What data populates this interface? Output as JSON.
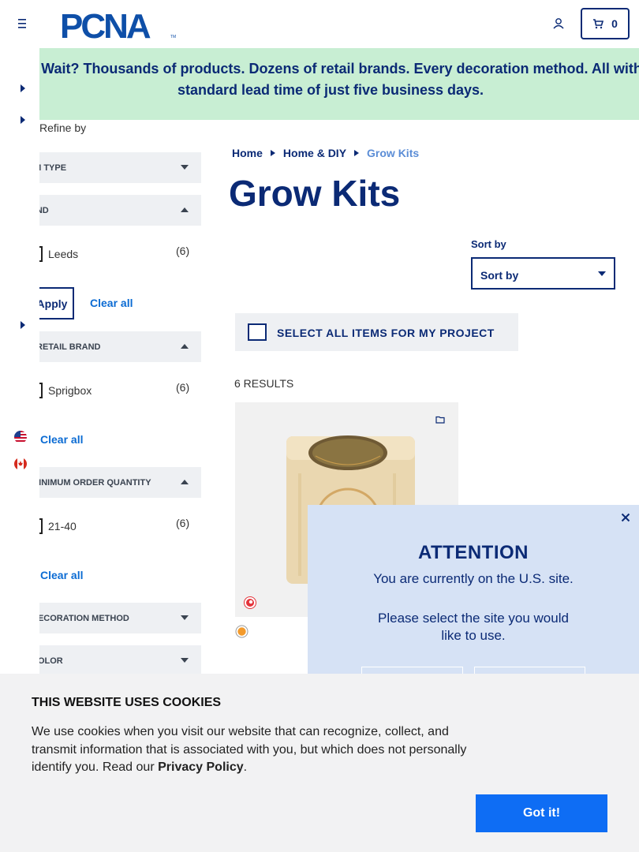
{
  "header": {
    "logo_text": "PCNA",
    "logo_tm": "TM",
    "cart_count": "0"
  },
  "banner": {
    "text": "Why Wait? Thousands of products. Dozens of retail brands. Every decoration method. All with a standard lead time of just five business days."
  },
  "filters": {
    "refine_label": "Refine by",
    "facets": [
      {
        "label": "ITEM TYPE"
      },
      {
        "label": "BRAND",
        "options": [
          {
            "name": "Leeds",
            "count": "(6)"
          }
        ]
      },
      {
        "label": "RETAIL BRAND",
        "options": [
          {
            "name": "Sprigbox",
            "count": "(6)"
          }
        ]
      },
      {
        "label": "MINIMUM ORDER QUANTITY",
        "options": [
          {
            "name": "21-40",
            "count": "(6)"
          }
        ]
      },
      {
        "label": "DECORATION METHOD"
      },
      {
        "label": "COLOR"
      }
    ],
    "apply_label": "Apply",
    "clear_all_label": "Clear all"
  },
  "breadcrumb": [
    "Home",
    "Home & DIY",
    "Grow Kits"
  ],
  "page_title": "Grow Kits",
  "sort": {
    "label": "Sort by",
    "selected": "Sort by"
  },
  "select_all_label": "SELECT ALL ITEMS FOR MY PROJECT",
  "results_label": "6 RESULTS",
  "modal": {
    "title": "ATTENTION",
    "message": "You are currently on the U.S. site.",
    "question": "Please select the site you would like to use."
  },
  "cookie": {
    "title": "THIS WEBSITE USES COOKIES",
    "text": "We use cookies when you visit our website that can recognize, collect, and transmit information that is associated with you, but which does not personally identify you. Read our",
    "link": "Privacy Policy",
    "period": ".",
    "button": "Got it!"
  },
  "colors": {
    "navy": "#0b2a75",
    "banner_bg": "#c8eed3",
    "accent_blue": "#0e6df4",
    "modal_bg": "#d6e2f5"
  }
}
